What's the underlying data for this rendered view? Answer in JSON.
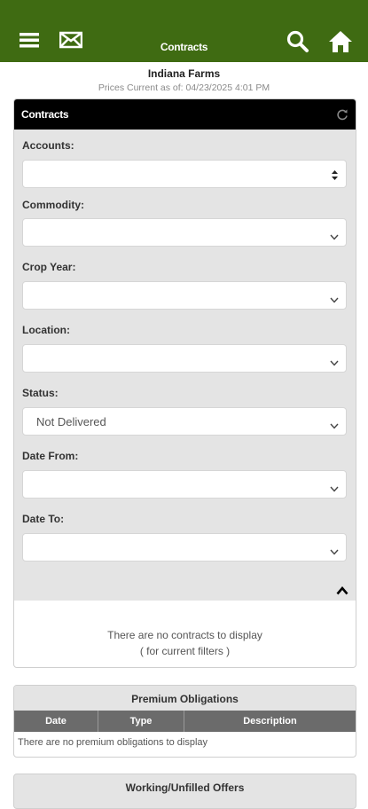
{
  "header": {
    "title": "Contracts",
    "menu_icon": "menu-icon",
    "mail_icon": "mail-icon",
    "search_icon": "search-icon",
    "home_icon": "home-icon"
  },
  "account": {
    "farm_name": "Indiana Farms",
    "prices_current": "Prices Current as of: 04/23/2025 4:01 PM"
  },
  "contracts_panel": {
    "title": "Contracts",
    "filters": {
      "accounts_label": "Accounts:",
      "accounts_value": "",
      "commodity_label": "Commodity:",
      "commodity_value": "",
      "crop_year_label": "Crop Year:",
      "crop_year_value": "",
      "location_label": "Location:",
      "location_value": "",
      "status_label": "Status:",
      "status_value": "Not Delivered",
      "date_from_label": "Date From:",
      "date_from_value": "",
      "date_to_label": "Date To:",
      "date_to_value": ""
    },
    "empty_message": "There are no contracts to display",
    "empty_sub": "( for current filters )"
  },
  "premium_obligations": {
    "title": "Premium Obligations",
    "columns": [
      "Date",
      "Type",
      "Description"
    ],
    "empty_message": "There are no premium obligations to display"
  },
  "working_offers": {
    "title": "Working/Unfilled Offers"
  },
  "colors": {
    "header_bg": "#3f6b12",
    "panel_header_bg": "#000000",
    "filter_bg": "#e4e4e4",
    "table_header_bg": "#6b6b6b"
  }
}
